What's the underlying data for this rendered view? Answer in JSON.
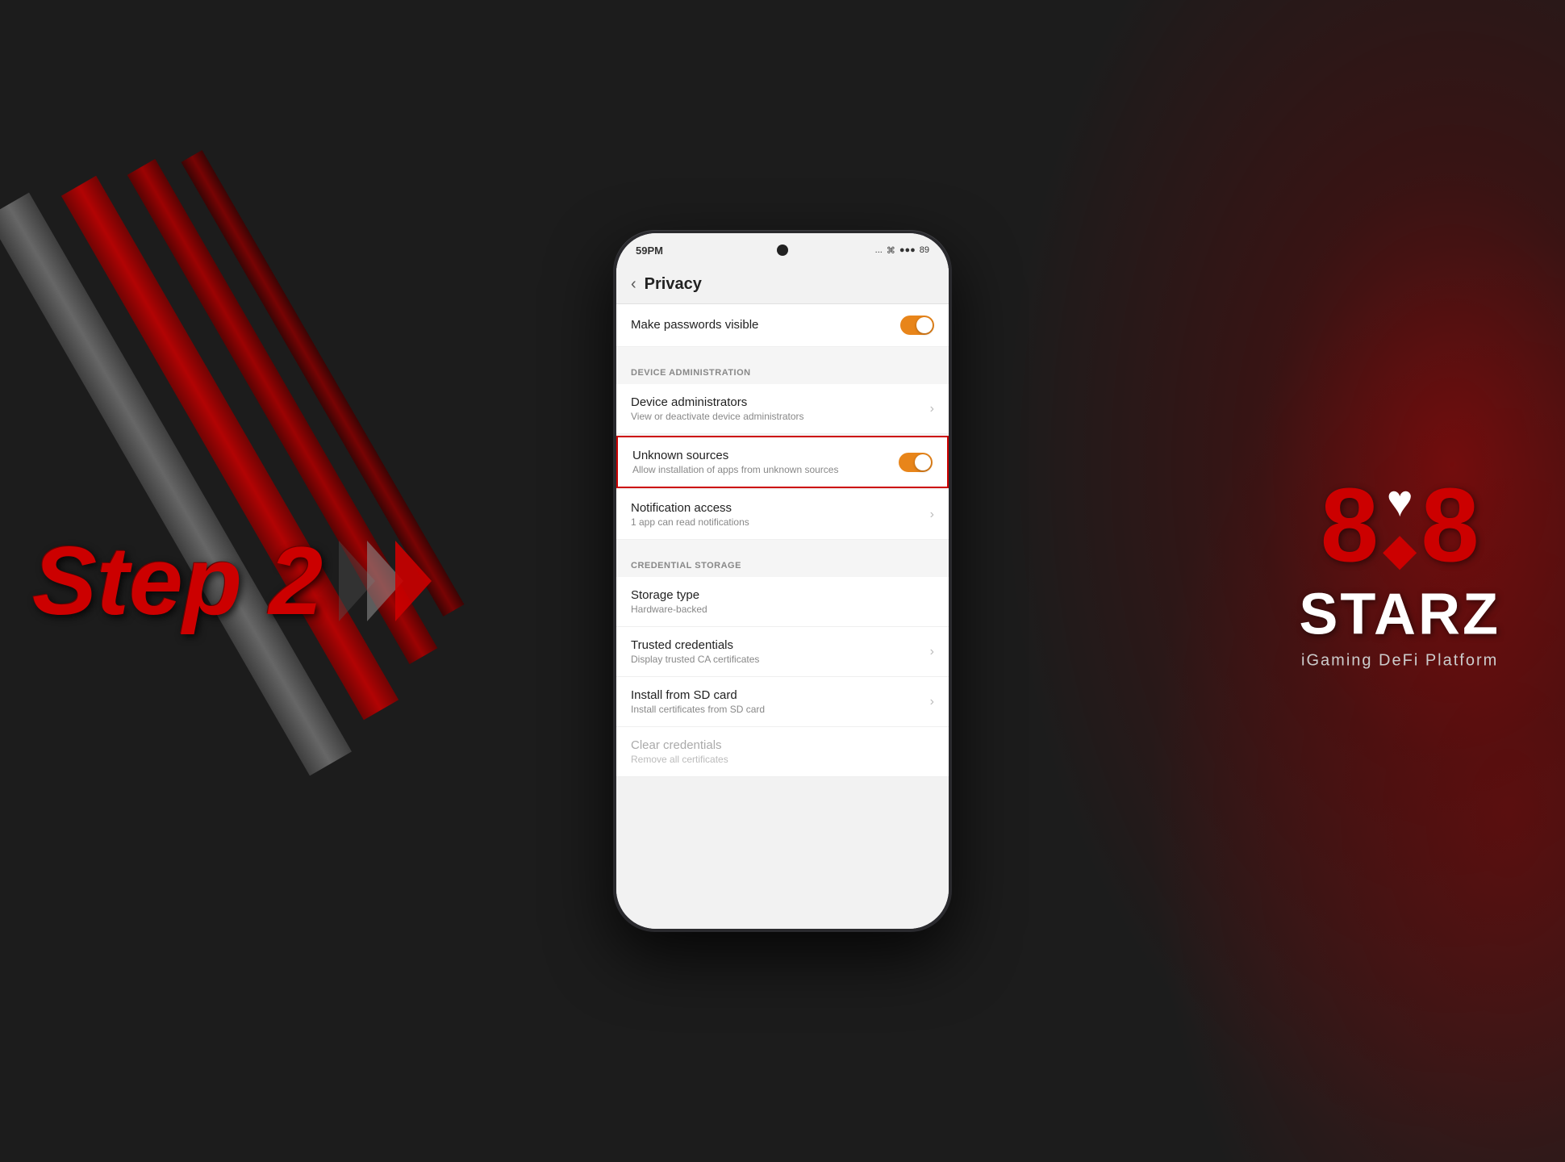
{
  "background": {
    "color": "#1c1c1c"
  },
  "step_label": "Step 2",
  "logo": {
    "number": "8",
    "heart_suit": "♥",
    "diamond_suit": "◆",
    "brand": "STARZ",
    "subtitle": "iGaming DeFi Platform"
  },
  "phone": {
    "status_bar": {
      "time": "59PM",
      "dots": "...",
      "battery": "89"
    },
    "header": {
      "back_label": "‹",
      "title": "Privacy"
    },
    "items": [
      {
        "id": "make-passwords",
        "title": "Make passwords visible",
        "subtitle": "",
        "has_toggle": true,
        "toggle_on": true,
        "has_chevron": false,
        "section": null,
        "highlighted": false,
        "dimmed": false
      },
      {
        "id": "section-device-admin",
        "section_title": "DEVICE ADMINISTRATION",
        "is_section": true
      },
      {
        "id": "device-administrators",
        "title": "Device administrators",
        "subtitle": "View or deactivate device administrators",
        "has_toggle": false,
        "toggle_on": false,
        "has_chevron": true,
        "highlighted": false,
        "dimmed": false
      },
      {
        "id": "unknown-sources",
        "title": "Unknown sources",
        "subtitle": "Allow installation of apps from unknown sources",
        "has_toggle": true,
        "toggle_on": true,
        "has_chevron": false,
        "highlighted": true,
        "dimmed": false
      },
      {
        "id": "notification-access",
        "title": "Notification access",
        "subtitle": "1 app can read notifications",
        "has_toggle": false,
        "toggle_on": false,
        "has_chevron": true,
        "highlighted": false,
        "dimmed": false
      },
      {
        "id": "section-credential",
        "section_title": "CREDENTIAL STORAGE",
        "is_section": true
      },
      {
        "id": "storage-type",
        "title": "Storage type",
        "subtitle": "Hardware-backed",
        "has_toggle": false,
        "toggle_on": false,
        "has_chevron": false,
        "highlighted": false,
        "dimmed": false
      },
      {
        "id": "trusted-credentials",
        "title": "Trusted credentials",
        "subtitle": "Display trusted CA certificates",
        "has_toggle": false,
        "toggle_on": false,
        "has_chevron": true,
        "highlighted": false,
        "dimmed": false
      },
      {
        "id": "install-sd-card",
        "title": "Install from SD card",
        "subtitle": "Install certificates from SD card",
        "has_toggle": false,
        "toggle_on": false,
        "has_chevron": true,
        "highlighted": false,
        "dimmed": false
      },
      {
        "id": "clear-credentials",
        "title": "Clear credentials",
        "subtitle": "Remove all certificates",
        "has_toggle": false,
        "toggle_on": false,
        "has_chevron": false,
        "highlighted": false,
        "dimmed": true
      }
    ]
  }
}
